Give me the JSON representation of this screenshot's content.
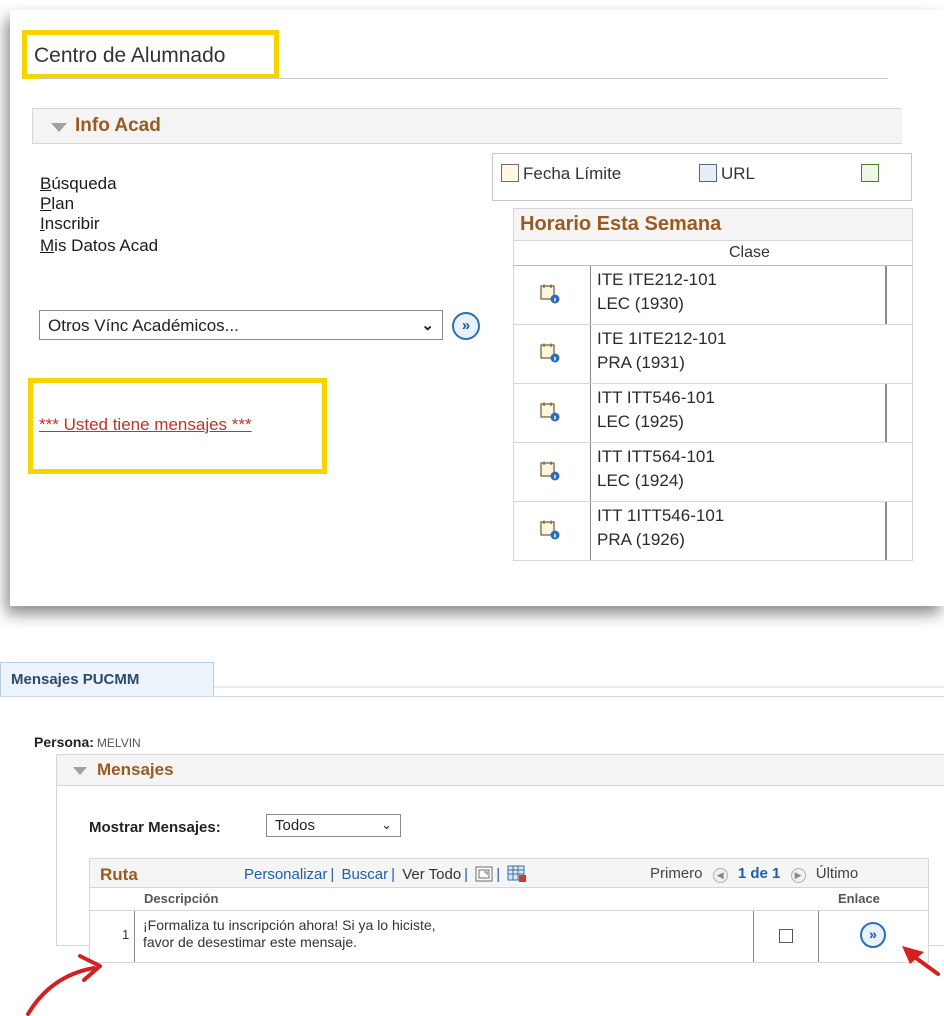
{
  "top": {
    "page_title": "Centro de Alumnado",
    "section_title": "Info Acad",
    "links": [
      "Búsqueda",
      "Plan",
      "Inscribir",
      "Mis Datos Acad"
    ],
    "other_links_select": "Otros Vínc Académicos...",
    "messages_link": "*** Usted tiene mensajes ***",
    "toolbar": {
      "deadline_label": "Fecha Límite",
      "url_label": "URL"
    },
    "schedule": {
      "title": "Horario Esta Semana",
      "column": "Clase",
      "rows": [
        {
          "line1": "ITE ITE212-101",
          "line2": "LEC (1930)"
        },
        {
          "line1": "ITE 1ITE212-101",
          "line2": "PRA (1931)"
        },
        {
          "line1": "ITT ITT546-101",
          "line2": "LEC (1925)"
        },
        {
          "line1": "ITT ITT564-101",
          "line2": "LEC (1924)"
        },
        {
          "line1": "ITT 1ITT546-101",
          "line2": "PRA (1926)"
        }
      ]
    }
  },
  "bottom": {
    "tab_label": "Mensajes PUCMM",
    "persona_label": "Persona:",
    "persona_value": "MELVIN",
    "section_title": "Mensajes",
    "show_label": "Mostrar Mensajes:",
    "show_value": "Todos",
    "grid": {
      "title": "Ruta",
      "customize": "Personalizar",
      "search": "Buscar",
      "view_all": "Ver Todo",
      "first": "Primero",
      "page": "1 de 1",
      "last": "Último",
      "col_description": "Descripción",
      "col_link": "Enlace",
      "rows": [
        {
          "num": "1",
          "line1": "¡Formaliza tu inscripción ahora! Si ya lo hiciste,",
          "line2": "favor de desestimar este mensaje."
        }
      ]
    }
  },
  "colors": {
    "highlight": "#f5d400",
    "section_text": "#9a5b21",
    "link_blue": "#1f5ea8",
    "message_red": "#c0322c",
    "annotation_red": "#d42020"
  },
  "icons": [
    "calendar-info-icon",
    "url-icon",
    "checklist-icon",
    "go-arrow-icon",
    "prev-page-icon",
    "next-page-icon",
    "zoom-icon",
    "download-grid-icon",
    "collapse-triangle-icon"
  ]
}
